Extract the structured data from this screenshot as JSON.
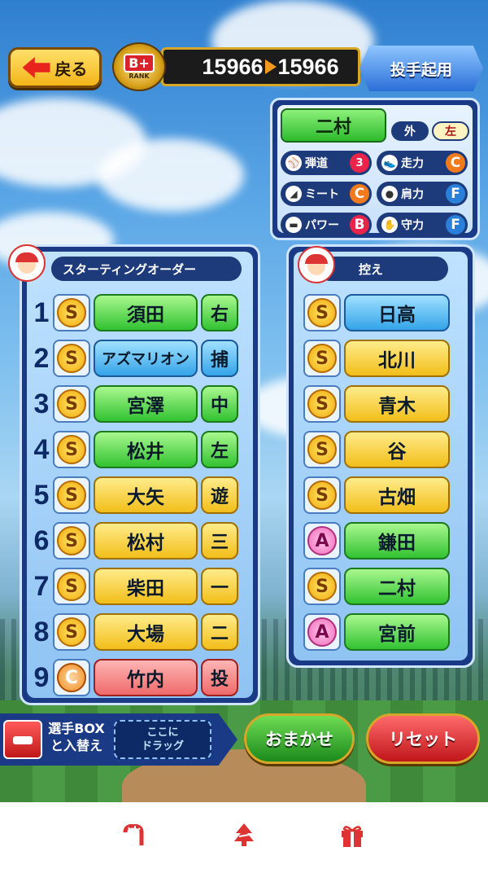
{
  "header": {
    "back_label": "戻る",
    "rank_letter": "B+",
    "rank_word": "RANK",
    "score_before": "15966",
    "score_after": "15966",
    "pitcher_button_label": "投手起用"
  },
  "detail": {
    "name": "二村",
    "position": "外",
    "throws": "左",
    "trajectory_label": "弾道",
    "trajectory_value": "3",
    "stats": [
      {
        "label": "ミート",
        "grade": "C",
        "color": "#f07a1c"
      },
      {
        "label": "パワー",
        "grade": "B",
        "color": "#e8244a"
      },
      {
        "label": "走力",
        "grade": "C",
        "color": "#f07a1c"
      },
      {
        "label": "肩力",
        "grade": "F",
        "color": "#2a7fd8"
      },
      {
        "label": "守力",
        "grade": "F",
        "color": "#2a7fd8"
      }
    ]
  },
  "starting": {
    "title": "スターティングオーダー",
    "rows": [
      {
        "num": "1",
        "grade": "S",
        "name": "須田",
        "pos": "右",
        "color": "green"
      },
      {
        "num": "2",
        "grade": "S",
        "name": "アズマリオン",
        "pos": "捕",
        "color": "blue"
      },
      {
        "num": "3",
        "grade": "S",
        "name": "宮澤",
        "pos": "中",
        "color": "green"
      },
      {
        "num": "4",
        "grade": "S",
        "name": "松井",
        "pos": "左",
        "color": "green"
      },
      {
        "num": "5",
        "grade": "S",
        "name": "大矢",
        "pos": "遊",
        "color": "yellow"
      },
      {
        "num": "6",
        "grade": "S",
        "name": "松村",
        "pos": "三",
        "color": "yellow"
      },
      {
        "num": "7",
        "grade": "S",
        "name": "柴田",
        "pos": "一",
        "color": "yellow"
      },
      {
        "num": "8",
        "grade": "S",
        "name": "大場",
        "pos": "二",
        "color": "yellow"
      },
      {
        "num": "9",
        "grade": "C",
        "name": "竹内",
        "pos": "投",
        "color": "red"
      }
    ]
  },
  "bench": {
    "title": "控え",
    "rows": [
      {
        "grade": "S",
        "name": "日高",
        "color": "blue"
      },
      {
        "grade": "S",
        "name": "北川",
        "color": "yellow"
      },
      {
        "grade": "S",
        "name": "青木",
        "color": "yellow"
      },
      {
        "grade": "S",
        "name": "谷",
        "color": "yellow"
      },
      {
        "grade": "S",
        "name": "古畑",
        "color": "yellow"
      },
      {
        "grade": "A",
        "name": "鎌田",
        "color": "green"
      },
      {
        "grade": "S",
        "name": "二村",
        "color": "green"
      },
      {
        "grade": "A",
        "name": "宮前",
        "color": "green"
      }
    ]
  },
  "footer": {
    "swap_line1": "選手BOX",
    "swap_line2": "と入替え",
    "drag_line1": "ここに",
    "drag_line2": "ドラッグ",
    "auto_label": "おまかせ",
    "reset_label": "リセット"
  },
  "tabs": [
    "candy-cane-icon",
    "tree-icon",
    "gift-icon"
  ]
}
